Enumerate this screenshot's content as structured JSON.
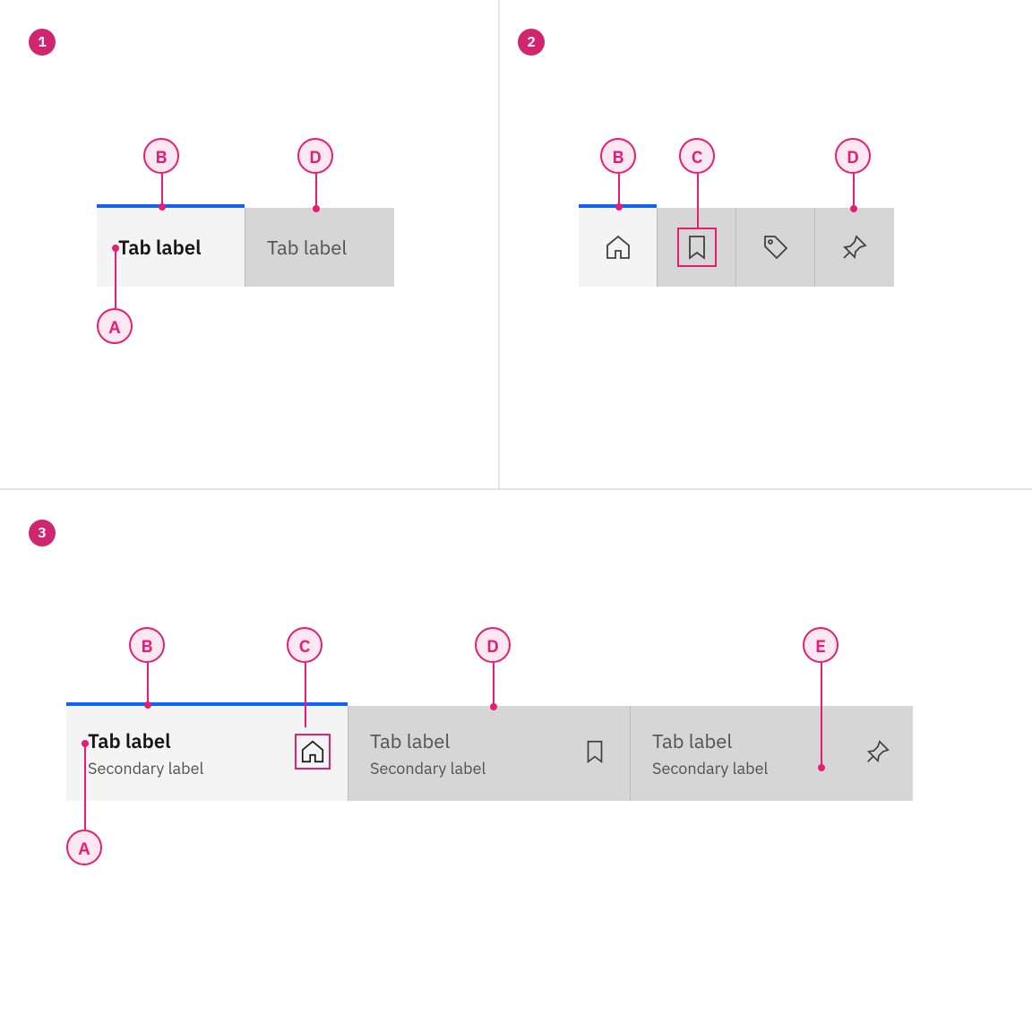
{
  "sections": {
    "one": "1",
    "two": "2",
    "three": "3"
  },
  "annotations": {
    "a": "A",
    "b": "B",
    "c": "C",
    "d": "D",
    "e": "E"
  },
  "example1": {
    "tab1": "Tab label",
    "tab2": "Tab label"
  },
  "example2": {
    "icon1": "home-icon",
    "icon2": "bookmark-icon",
    "icon3": "tag-icon",
    "icon4": "pin-icon"
  },
  "example3": {
    "tab1": {
      "primary": "Tab label",
      "secondary": "Secondary label"
    },
    "tab2": {
      "primary": "Tab label",
      "secondary": "Secondary label"
    },
    "tab3": {
      "primary": "Tab label",
      "secondary": "Secondary label"
    }
  }
}
